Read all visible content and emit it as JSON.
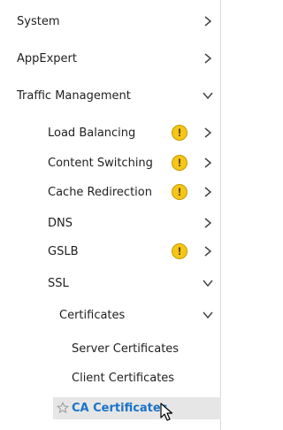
{
  "nav": {
    "top": [
      {
        "label": "System",
        "state": "collapsed"
      },
      {
        "label": "AppExpert",
        "state": "collapsed"
      },
      {
        "label": "Traffic Management",
        "state": "expanded"
      }
    ],
    "traffic_management": [
      {
        "label": "Load Balancing",
        "warning": true,
        "state": "collapsed"
      },
      {
        "label": "Content Switching",
        "warning": true,
        "state": "collapsed"
      },
      {
        "label": "Cache Redirection",
        "warning": true,
        "state": "collapsed"
      },
      {
        "label": "DNS",
        "warning": false,
        "state": "collapsed"
      },
      {
        "label": "GSLB",
        "warning": true,
        "state": "collapsed"
      },
      {
        "label": "SSL",
        "warning": false,
        "state": "expanded"
      }
    ],
    "ssl": {
      "certificates": {
        "label": "Certificates",
        "state": "expanded",
        "items": [
          {
            "label": "Server Certificates"
          },
          {
            "label": "Client Certificates"
          },
          {
            "label": "CA Certificates",
            "selected": true
          }
        ]
      }
    },
    "warning_glyph": "!",
    "colors": {
      "selected_text": "#1a73c8",
      "warning": "#f5c518",
      "selected_bg": "#e6e6e6"
    }
  }
}
